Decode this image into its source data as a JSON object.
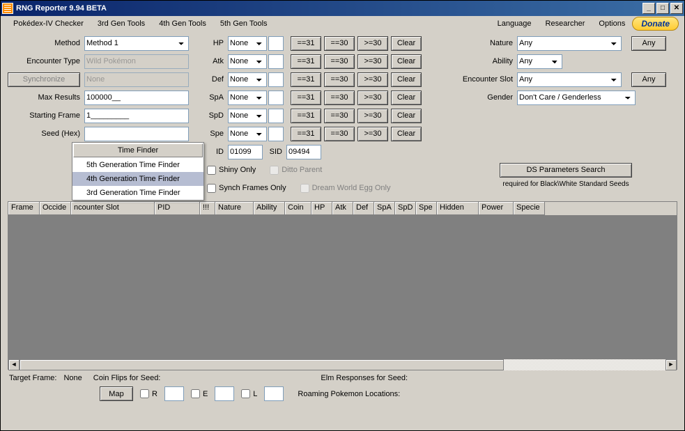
{
  "window": {
    "title": "RNG Reporter 9.94 BETA"
  },
  "menu": {
    "pokedex": "Pokédex-IV Checker",
    "gen3": "3rd Gen Tools",
    "gen4": "4th Gen Tools",
    "gen5": "5th Gen Tools",
    "language": "Language",
    "researcher": "Researcher",
    "options": "Options",
    "donate": "Donate"
  },
  "labels": {
    "method": "Method",
    "encounter_type": "Encounter Type",
    "synchronize": "Synchronize",
    "max_results": "Max Results",
    "starting_frame": "Starting Frame",
    "seed_hex": "Seed (Hex)",
    "hp": "HP",
    "atk": "Atk",
    "def": "Def",
    "spa": "SpA",
    "spd": "SpD",
    "spe": "Spe",
    "id": "ID",
    "sid": "SID",
    "nature": "Nature",
    "ability": "Ability",
    "encounter_slot": "Encounter Slot",
    "gender": "Gender",
    "shiny_only": "Shiny Only",
    "synch_frames": "Synch Frames Only",
    "ditto_parent": "Ditto Parent",
    "dream_world": "Dream World Egg Only",
    "ds_param": "DS Parameters Search",
    "ds_note": "required for Black\\White Standard Seeds",
    "any": "Any",
    "clear": "Clear",
    "eq31": "==31",
    "eq30": "==30",
    "ge30": ">=30",
    "target_frame": "Target Frame:",
    "target_frame_val": "None",
    "coin_flips": "Coin Flips for Seed:",
    "elm_resp": "Elm Responses for Seed:",
    "map": "Map",
    "r": "R",
    "e": "E",
    "l": "L",
    "roaming": "Roaming Pokemon Locations:"
  },
  "fields": {
    "method": "Method 1",
    "encounter_type": "Wild Pokémon",
    "synchronize": "None",
    "max_results": "100000__",
    "starting_frame": "1_________",
    "seed_hex": "",
    "stat_none": "None",
    "id": "01099",
    "sid": "09494",
    "nature": "Any",
    "ability": "Any",
    "encounter_slot": "Any",
    "gender": "Don't Care / Genderless"
  },
  "time_finder": {
    "header": "Time Finder",
    "items": [
      "5th Generation Time Finder",
      "4th Generation Time Finder",
      "3rd Generation Time Finder"
    ],
    "hover_index": 1
  },
  "grid_columns": [
    "Frame",
    "Occide",
    "ncounter Slot",
    "PID",
    "!!!",
    "Nature",
    "Ability",
    "Coin",
    "HP",
    "Atk",
    "Def",
    "SpA",
    "SpD",
    "Spe",
    "Hidden",
    "Power",
    "Specie"
  ],
  "grid_col_widths": [
    45,
    45,
    120,
    65,
    22,
    55,
    45,
    38,
    30,
    30,
    30,
    30,
    30,
    30,
    60,
    50,
    45
  ]
}
